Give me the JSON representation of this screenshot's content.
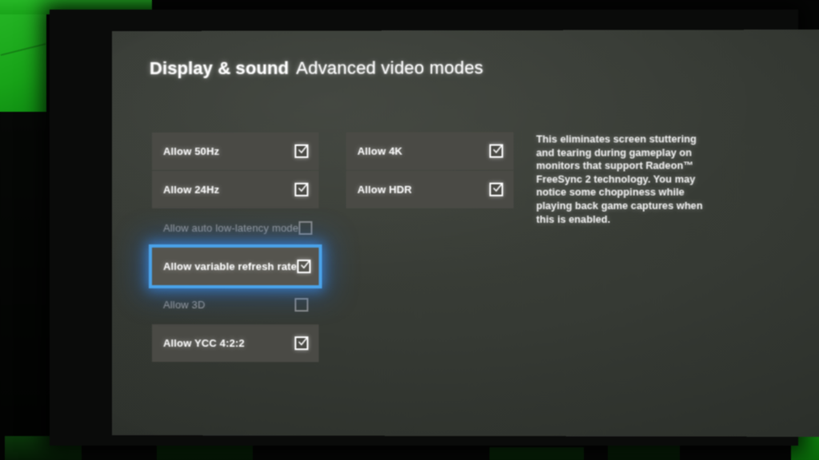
{
  "header": {
    "title": "Display & sound",
    "subtitle": "Advanced video modes"
  },
  "colors": {
    "focus_border": "#4aa3ea",
    "row_background": "#4a4a45",
    "screen_background": "#363a34",
    "accent_green": "#1fad1f",
    "label_enabled": "#ffffff",
    "label_dimmed": "#9a9a98"
  },
  "columns": {
    "left": {
      "items": [
        {
          "label": "Allow 50Hz",
          "checked": true,
          "enabled": true,
          "focused": false
        },
        {
          "label": "Allow 24Hz",
          "checked": true,
          "enabled": true,
          "focused": false
        },
        {
          "label": "Allow auto low-latency mode",
          "checked": false,
          "enabled": false,
          "focused": false
        },
        {
          "label": "Allow variable refresh rate",
          "checked": true,
          "enabled": true,
          "focused": true
        },
        {
          "label": "Allow 3D",
          "checked": false,
          "enabled": false,
          "focused": false
        },
        {
          "label": "Allow YCC 4:2:2",
          "checked": true,
          "enabled": true,
          "focused": false
        }
      ]
    },
    "right": {
      "items": [
        {
          "label": "Allow 4K",
          "checked": true,
          "enabled": true,
          "focused": false
        },
        {
          "label": "Allow HDR",
          "checked": true,
          "enabled": true,
          "focused": false
        }
      ]
    }
  },
  "description": {
    "text": "This eliminates screen stuttering and tearing during gameplay on monitors that support Radeon™ FreeSync 2 technology. You may notice some choppiness while playing back game captures when this is enabled."
  }
}
